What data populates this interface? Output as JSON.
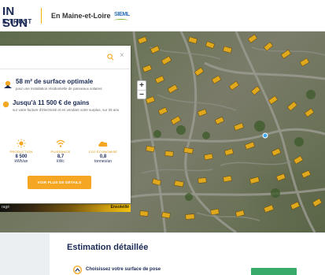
{
  "header": {
    "brand_main": "IN SUN",
    "brand_sub": "E TRUST",
    "region": "En Maine-et-Loire",
    "partner_logo_text": "SIEML"
  },
  "map": {
    "zoom_in": "+",
    "zoom_out": "−",
    "legend_left": "ragé",
    "legend_right": "Ensoleillé"
  },
  "search": {
    "placeholder": "",
    "value": "",
    "clear_label": "×"
  },
  "features": [
    {
      "icon": "roof-sun-icon",
      "title": "58 m² de surface optimale",
      "subtitle": "pour une installation résidentielle de panneaux solaires"
    },
    {
      "icon": "money-icon",
      "title": "Jusqu'à 11 500 € de gains",
      "subtitle": "sur votre facture d'électricité et en vendant votre surplus, sur 25 ans"
    }
  ],
  "stats": [
    {
      "icon": "sun-icon",
      "label": "PRODUCTION",
      "value": "8 500",
      "unit": "kWh/an"
    },
    {
      "icon": "power-icon",
      "label": "PUISSANCE",
      "value": "8,7",
      "unit": "kWc"
    },
    {
      "icon": "cloud-icon",
      "label": "CO2 ÉCONOMISÉ",
      "value": "0,8",
      "unit": "tonnes/an"
    }
  ],
  "cta_label": "VOIR PLUS DE DÉTAILS",
  "details": {
    "title": "Estimation détaillée",
    "row_text": "Choisissez votre surface de pose"
  },
  "colors": {
    "brand": "#1b2a55",
    "accent": "#f5a623",
    "stat_label": "#d88f00",
    "cta_green": "#3aaa6a"
  }
}
